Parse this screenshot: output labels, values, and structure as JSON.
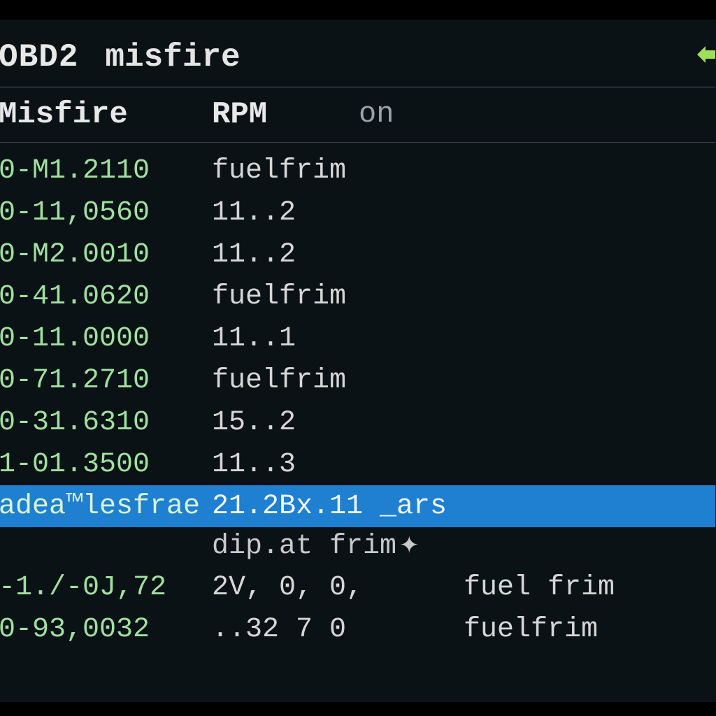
{
  "title": {
    "primary": "OBD2",
    "secondary": "misfire"
  },
  "headers": {
    "col1": "Misfire",
    "col2": "RPM",
    "col3": "on"
  },
  "rows": [
    {
      "c1": "0-M1.2110",
      "c2": "fuelfrim",
      "c3": ""
    },
    {
      "c1": "0-11,0560",
      "c2": "11..2",
      "c3": ""
    },
    {
      "c1": "0-M2.0010",
      "c2": "11..2",
      "c3": ""
    },
    {
      "c1": "0-41.0620",
      "c2": "fuelfrim",
      "c3": ""
    },
    {
      "c1": "0-11.0000",
      "c2": "11..1",
      "c3": ""
    },
    {
      "c1": "0-71.2710",
      "c2": "fuelfrim",
      "c3": ""
    },
    {
      "c1": "0-31.6310",
      "c2": "15..2",
      "c3": ""
    },
    {
      "c1": "1-01.3500",
      "c2": "11..3",
      "c3": ""
    }
  ],
  "selected": {
    "c1": "adea™lesfrae",
    "c2": "21.2Bx.11 _ars",
    "c3": ""
  },
  "sub_label": "dip.at frim",
  "bottom_rows": [
    {
      "c1": "-1./-0J,72",
      "c2": "2V,  0,  0,",
      "c3": "fuel frim"
    },
    {
      "c1": "0-93,0032",
      "c2": "..32  7   0",
      "c3": "fuelfrim"
    }
  ],
  "colors": {
    "background": "#0b1216",
    "green": "#9fe09f",
    "selected_bg": "#1f7fd1",
    "text": "#e8e8e8"
  }
}
